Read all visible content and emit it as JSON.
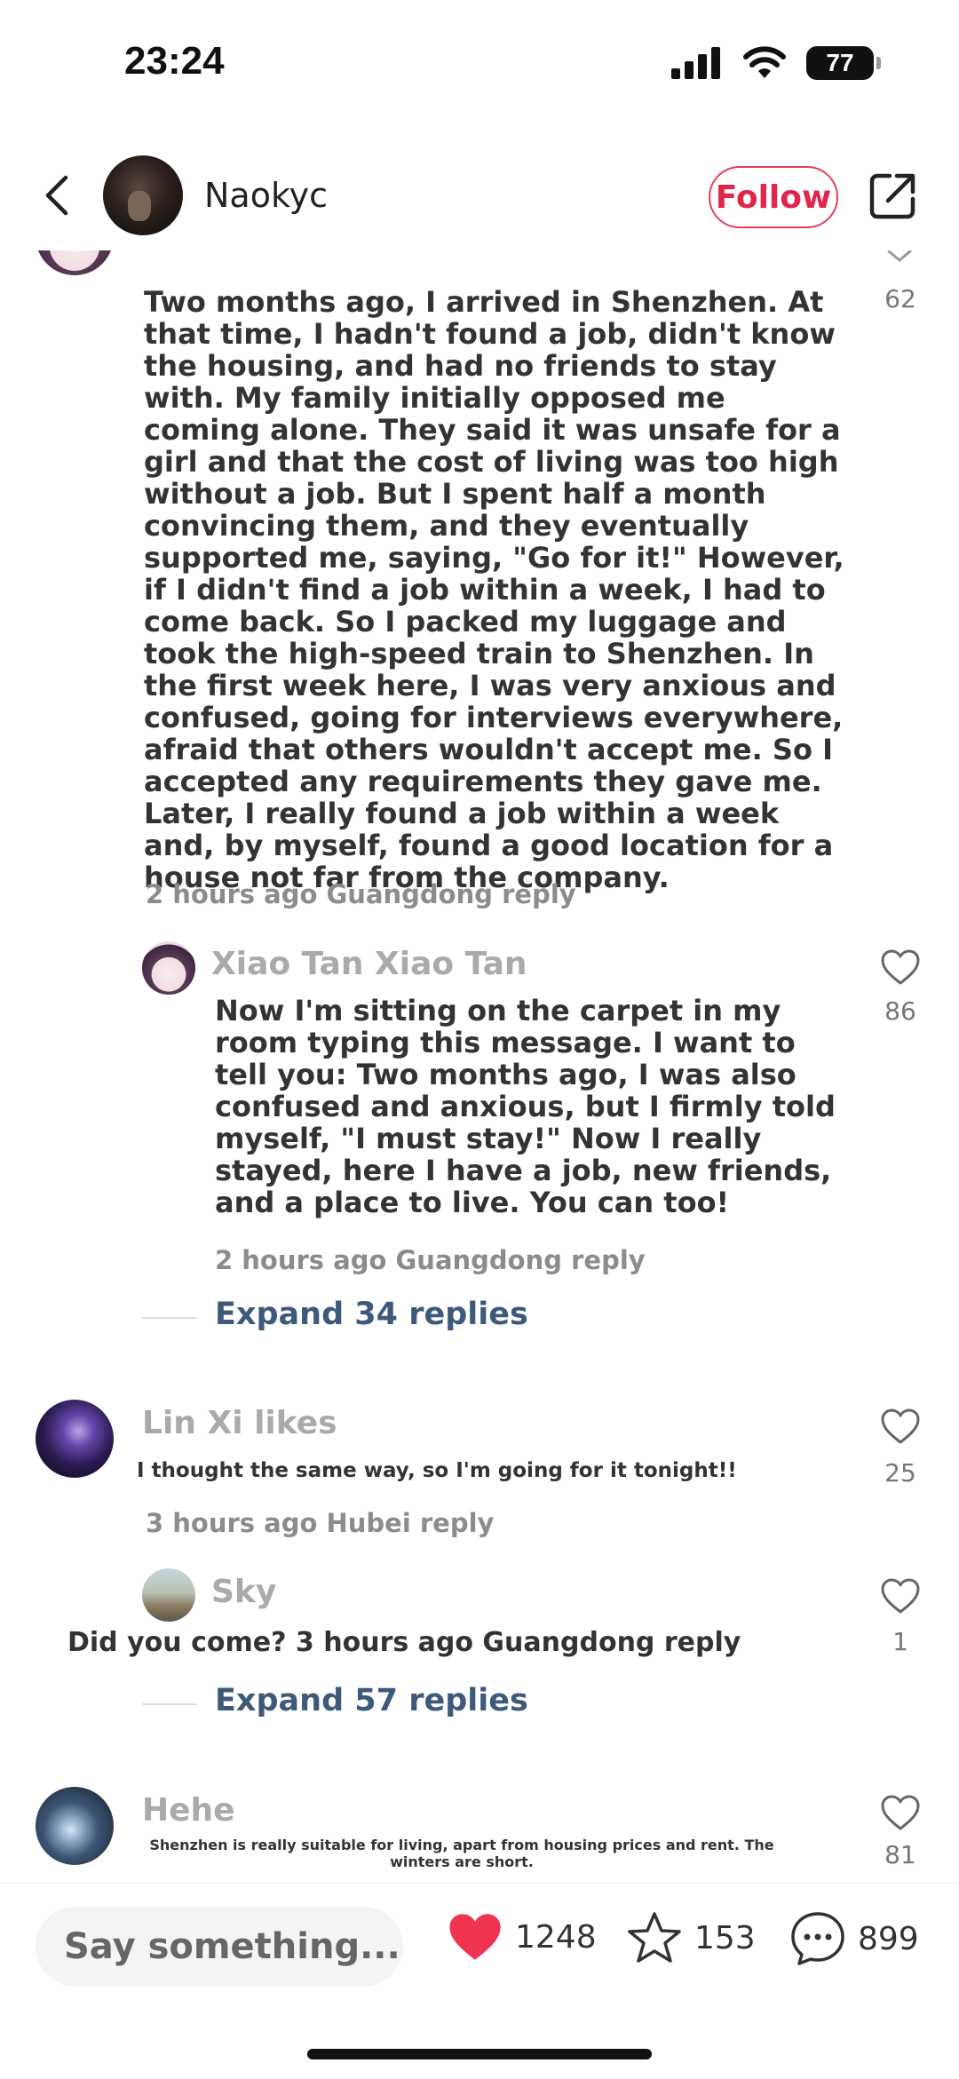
{
  "status_bar": {
    "time": "23:24",
    "battery": "77"
  },
  "header": {
    "author_name": "Naokyc",
    "follow_label": "Follow"
  },
  "comments": [
    {
      "text": "Two months ago, I arrived in Shenzhen. At that time, I hadn't found a job, didn't know the housing, and had no friends to stay with. My family initially opposed me coming alone. They said it was unsafe for a girl and that the cost of living was too high without a job. But I spent half a month convincing them, and they eventually supported me, saying, \"Go for it!\" However, if I didn't find a job within a week, I had to come back. So I packed my luggage and took the high-speed train to Shenzhen. In the first week here, I was very anxious and confused, going for interviews everywhere, afraid that others wouldn't accept me. So I accepted any requirements they gave me. Later, I really found a job within a week and, by myself, found a good location for a house not far from the company.",
      "meta": "2 hours ago Guangdong reply",
      "likes": "62",
      "reply": {
        "name": "Xiao Tan Xiao Tan",
        "text": "Now I'm sitting on the carpet in my room typing this message. I want to tell you: Two months ago, I was also confused and anxious, but I firmly told myself, \"I must stay!\" Now I really stayed, here I have a job, new friends, and a place to live. You can too!",
        "meta": "2 hours ago Guangdong reply",
        "likes": "86"
      },
      "expand_label": "Expand 34 replies"
    },
    {
      "name": "Lin Xi likes",
      "text": "I thought the same way, so I'm going for it tonight!!",
      "meta": "3 hours ago Hubei reply",
      "likes": "25",
      "reply": {
        "name": "Sky",
        "text": "Did you come? 3 hours ago Guangdong reply",
        "likes": "1"
      },
      "expand_label": "Expand 57 replies"
    },
    {
      "name": "Hehe",
      "text": "Shenzhen is really suitable for living, apart from housing prices and rent. The winters are short.",
      "likes": "81"
    }
  ],
  "bottom_bar": {
    "placeholder": "Say something...",
    "likes": "1248",
    "favorites": "153",
    "comments": "899"
  },
  "colors": {
    "accent": "#e0264a",
    "heart": "#f0334f",
    "link": "#3d5a7a"
  }
}
